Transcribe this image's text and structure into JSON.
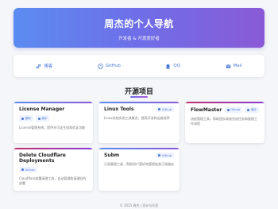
{
  "hero": {
    "title": "周杰的个人导航",
    "subtitle": "开发者 & 开源爱好者"
  },
  "links": [
    {
      "label": "博客",
      "icon": "link-icon"
    },
    {
      "label": "GitHub",
      "icon": "github-icon"
    },
    {
      "label": "QQ",
      "icon": "qq-icon"
    },
    {
      "label": "Mail",
      "icon": "mail-icon"
    }
  ],
  "section": {
    "title": "开源项目"
  },
  "projects": [
    {
      "title": "License Manager",
      "buttons": [
        "源码",
        "演示"
      ],
      "desc": "License管理系统，提供许可证生成和验证功能"
    },
    {
      "title": "Linux Tools",
      "buttons": [
        "Github"
      ],
      "desc": "Linux系统实用工具集合，提高开发和运维效率"
    },
    {
      "title": "FlowMaster",
      "buttons": [
        "Github",
        "演示"
      ],
      "desc": "流程管理工具，帮助团队高效完成任务和管理工作流程"
    },
    {
      "title": "Delete Cloudflare Deployments",
      "buttons": [
        "Github"
      ],
      "desc": "Cloudflare部署清理工具，自动管理和清理旧的部署"
    },
    {
      "title": "Subm",
      "buttons": [
        "Github"
      ],
      "desc": "订阅管理工具，帮助用户更好地管理各类订阅服务"
    }
  ],
  "footer": "© 2025 周杰 | 设计与开发",
  "colors": {
    "accent": "#4a78d8",
    "gradient_start": "#5b8cf0",
    "gradient_end": "#8a5ad6",
    "pink_accent": "#c0306a"
  }
}
